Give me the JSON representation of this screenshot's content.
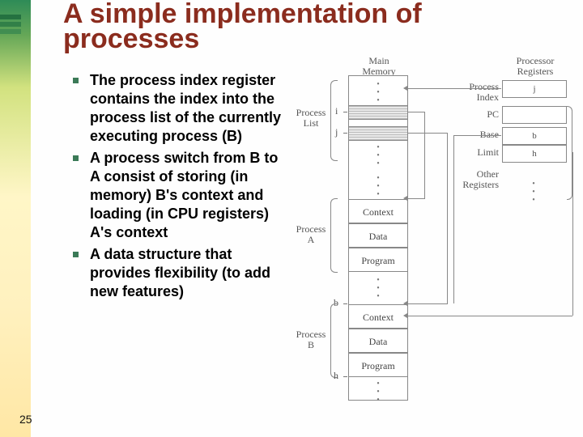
{
  "title": "A simple implementation of processes",
  "bullets": [
    "The process index register contains the index into the process list of the currently executing process (B)",
    "A process switch from B to A consist of storing (in memory) B's context and loading (in CPU registers) A's context",
    "A data structure that provides flexibility (to add new features)"
  ],
  "page_number": "25",
  "diagram": {
    "main_memory": "Main\nMemory",
    "processor_registers": "Processor\nRegisters",
    "process_list": "Process\nList",
    "process_a": "Process\nA",
    "process_b": "Process\nB",
    "context": "Context",
    "data": "Data",
    "program": "Program",
    "reg_process_index": "Process Index",
    "reg_pc": "PC",
    "reg_base": "Base",
    "reg_limit": "Limit",
    "other_registers": "Other\nRegisters",
    "i": "i",
    "j": "j",
    "b": "b",
    "h": "h"
  }
}
